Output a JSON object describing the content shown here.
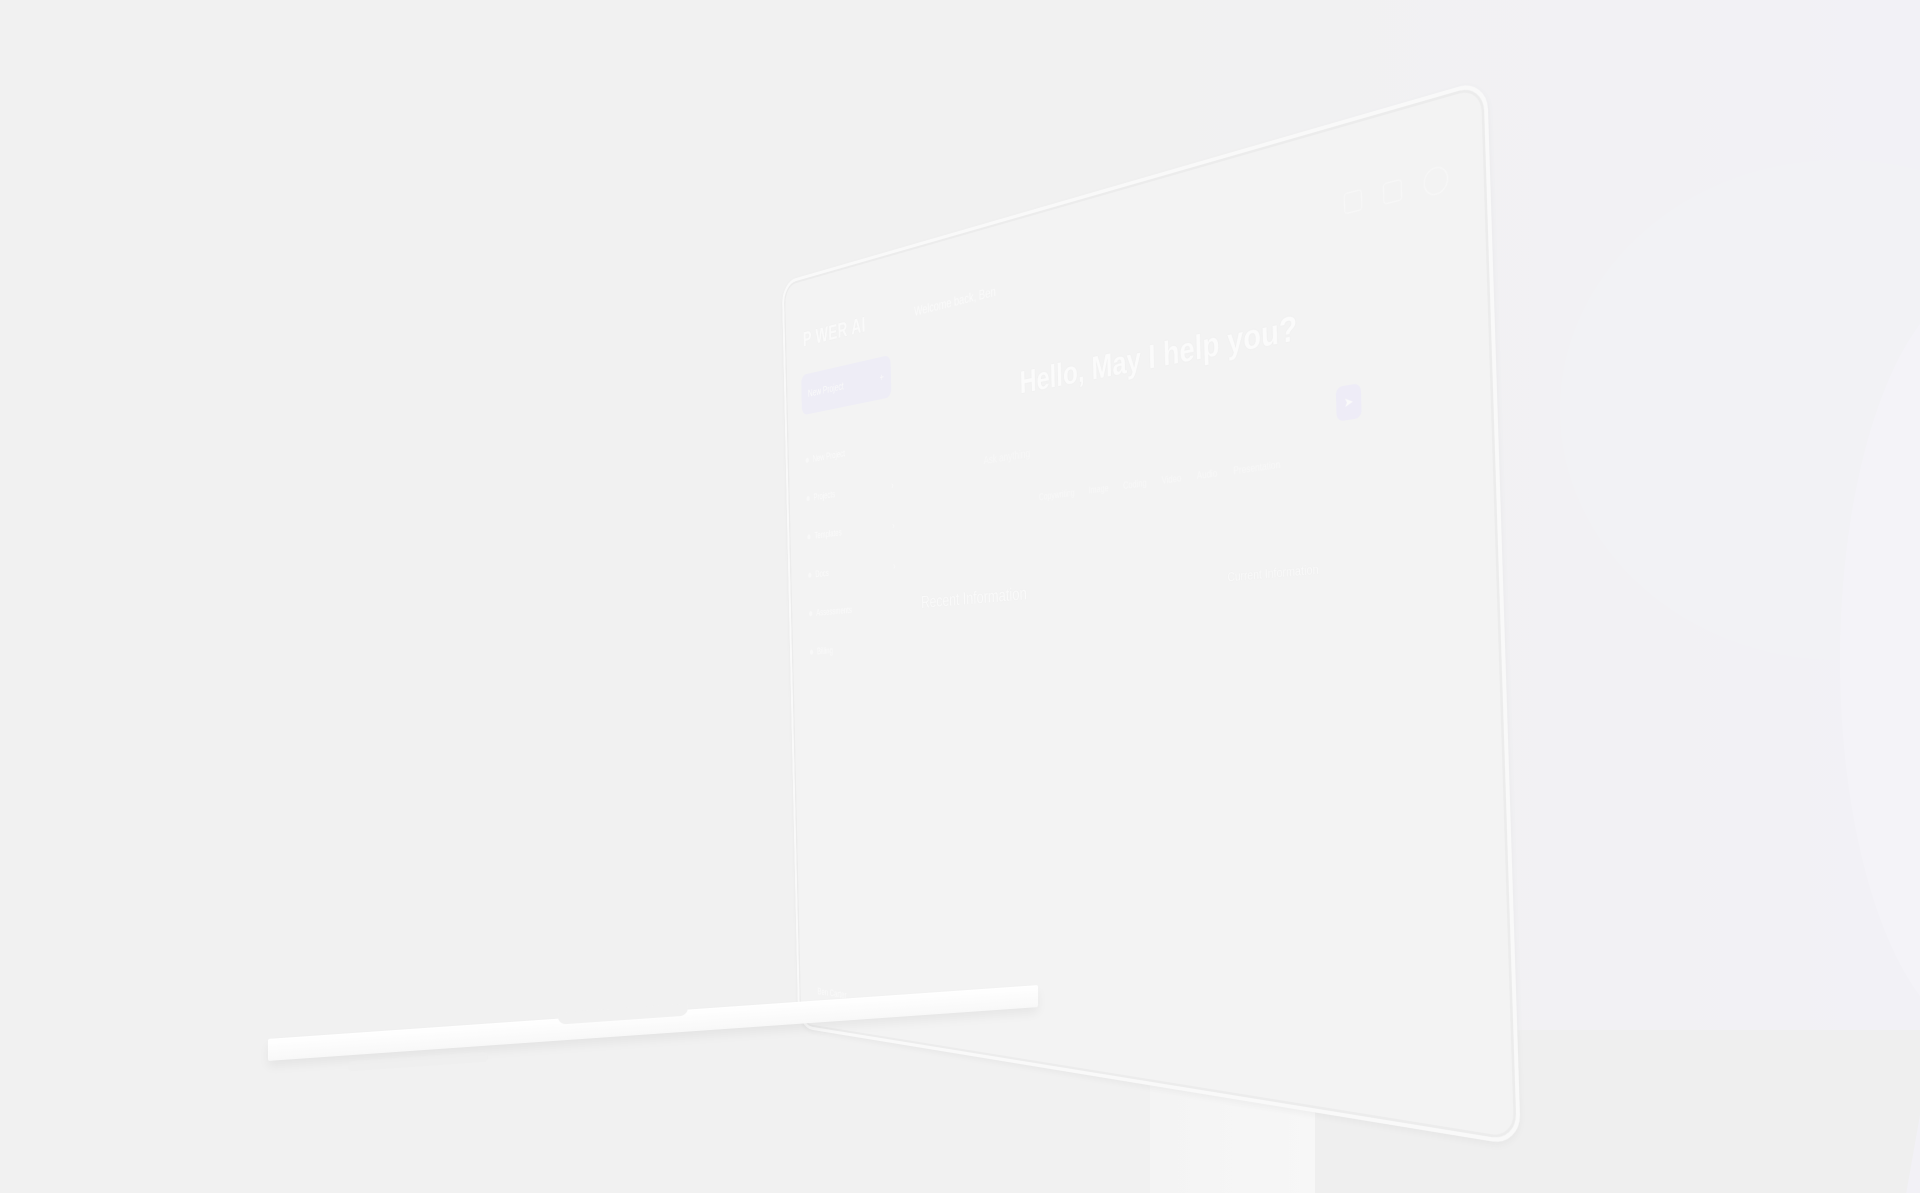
{
  "app": {
    "logo": "P  WER AI",
    "welcome": "Welcome back, Ben",
    "hero_title": "Hello, May I help you?",
    "new_chat_label": "New Project",
    "nav_items": [
      {
        "label": "New Project"
      },
      {
        "label": "Projects"
      },
      {
        "label": "Templates"
      },
      {
        "label": "Docs"
      },
      {
        "label": "Assessments"
      },
      {
        "label": "Billing"
      }
    ],
    "bottom_user_label": "Ben Carter",
    "search_placeholder": "Ask anything",
    "chips": [
      "Copywriting",
      "Image",
      "Coding",
      "Video",
      "Audio",
      "Presentation"
    ],
    "recent_title": "Recent Information",
    "recent_link": "Current Information"
  },
  "colors": {
    "background": "#f1f1f1",
    "accent": "#eeedf6"
  },
  "icons": {
    "send": "send-icon",
    "settings": "gear-icon",
    "notifications": "bell-icon",
    "power": "power-icon"
  }
}
